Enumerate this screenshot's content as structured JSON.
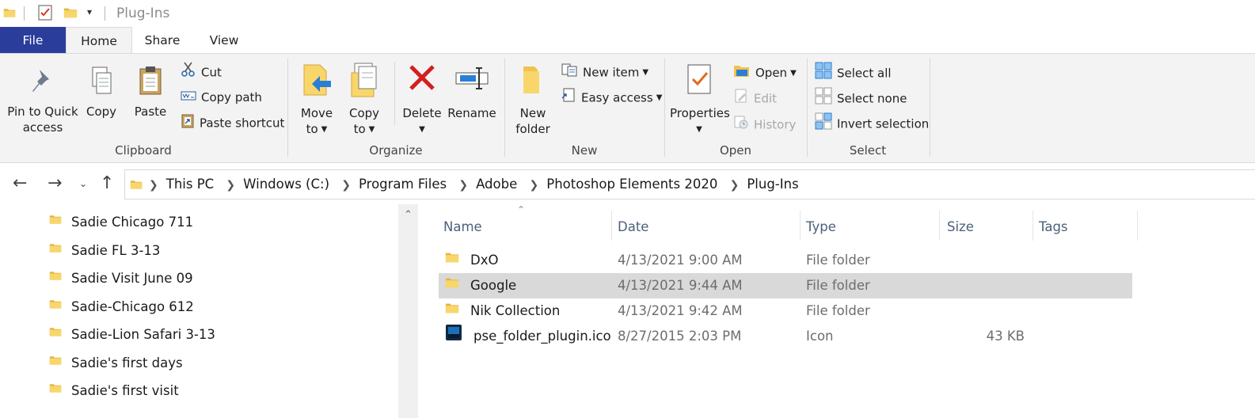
{
  "window": {
    "title": "Plug-Ins"
  },
  "tabs": [
    {
      "label": "File"
    },
    {
      "label": "Home"
    },
    {
      "label": "Share"
    },
    {
      "label": "View"
    }
  ],
  "ribbon": {
    "clipboard": {
      "label": "Clipboard",
      "pin_line1": "Pin to Quick",
      "pin_line2": "access",
      "copy": "Copy",
      "paste": "Paste",
      "cut": "Cut",
      "copy_path": "Copy path",
      "paste_shortcut": "Paste shortcut"
    },
    "organize": {
      "label": "Organize",
      "move_line1": "Move",
      "move_line2": "to",
      "copy_line1": "Copy",
      "copy_line2": "to",
      "delete": "Delete",
      "rename": "Rename"
    },
    "new": {
      "label": "New",
      "folder_line1": "New",
      "folder_line2": "folder",
      "new_item": "New item",
      "easy_access": "Easy access"
    },
    "open": {
      "label": "Open",
      "properties": "Properties",
      "open": "Open",
      "edit": "Edit",
      "history": "History"
    },
    "select": {
      "label": "Select",
      "select_all": "Select all",
      "select_none": "Select none",
      "invert": "Invert selection"
    }
  },
  "breadcrumbs": [
    "This PC",
    "Windows (C:)",
    "Program Files",
    "Adobe",
    "Photoshop Elements 2020",
    "Plug-Ins"
  ],
  "tree": [
    {
      "label": "Sadie Chicago 711"
    },
    {
      "label": "Sadie FL 3-13"
    },
    {
      "label": "Sadie Visit June 09"
    },
    {
      "label": "Sadie-Chicago 612"
    },
    {
      "label": "Sadie-Lion Safari 3-13"
    },
    {
      "label": "Sadie's first days"
    },
    {
      "label": "Sadie's first visit"
    }
  ],
  "columns": {
    "name": "Name",
    "date": "Date",
    "type": "Type",
    "size": "Size",
    "tags": "Tags"
  },
  "files": [
    {
      "name": "DxO",
      "date": "4/13/2021 9:00 AM",
      "type": "File folder",
      "size": "",
      "icon": "folder-icon",
      "selected": false
    },
    {
      "name": "Google",
      "date": "4/13/2021 9:44 AM",
      "type": "File folder",
      "size": "",
      "icon": "folder-icon",
      "selected": true
    },
    {
      "name": "Nik Collection",
      "date": "4/13/2021 9:42 AM",
      "type": "File folder",
      "size": "",
      "icon": "folder-icon",
      "selected": false
    },
    {
      "name": "pse_folder_plugin.ico",
      "date": "8/27/2015 2:03 PM",
      "type": "Icon",
      "size": "43 KB",
      "icon": "ico-file-icon",
      "selected": false
    }
  ],
  "colors": {
    "file_tab": "#2b3d9b",
    "ribbon_bg": "#f3f3f3",
    "selected_row": "#d9d9d9",
    "folder": "#f6c94a"
  }
}
